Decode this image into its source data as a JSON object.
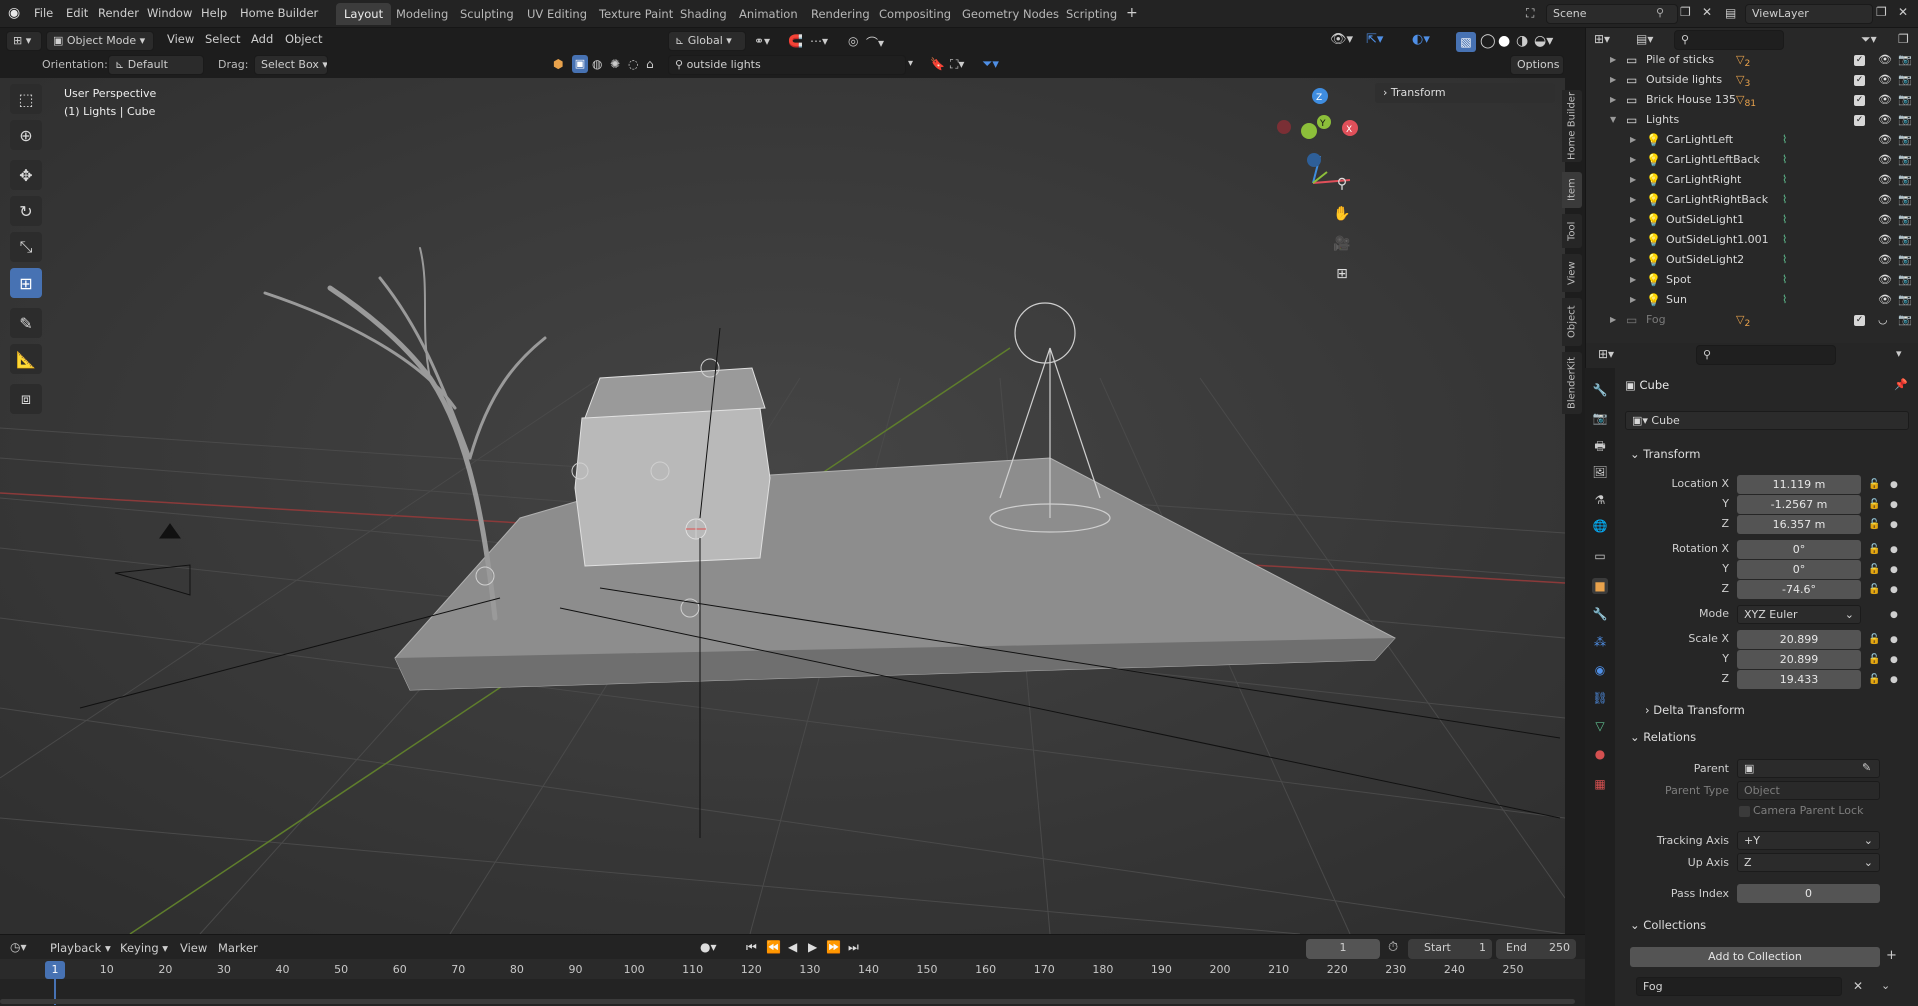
{
  "topbar": {
    "menus": [
      "File",
      "Edit",
      "Render",
      "Window",
      "Help",
      "Home Builder"
    ],
    "workspaces": [
      "Layout",
      "Modeling",
      "Sculpting",
      "UV Editing",
      "Texture Paint",
      "Shading",
      "Animation",
      "Rendering",
      "Compositing",
      "Geometry Nodes",
      "Scripting"
    ],
    "active_workspace": "Layout",
    "add_tab": "+",
    "scene": "Scene",
    "view_layer": "ViewLayer"
  },
  "viewport_header": {
    "mode": "Object Mode",
    "menus": [
      "View",
      "Select",
      "Add",
      "Object"
    ],
    "transform_orientation": "Global",
    "orientation_label": "Orientation:",
    "orientation_value": "Default",
    "drag_label": "Drag:",
    "drag_value": "Select Box",
    "search_value": "outside lights",
    "options": "Options"
  },
  "viewport": {
    "view_name": "User Perspective",
    "context": "(1) Lights | Cube",
    "sidebar_panel": "Transform",
    "side_tabs": [
      "Home Builder",
      "Item",
      "Tool",
      "View",
      "Object",
      "BlenderKit"
    ],
    "gizmo_axes": [
      "Z",
      "Y",
      "X"
    ]
  },
  "outliner": {
    "rows": [
      {
        "label": "Pile of sticks",
        "extra": "2",
        "kind": "collection"
      },
      {
        "label": "Outside lights",
        "extra": "3",
        "kind": "collection"
      },
      {
        "label": "Brick House 135",
        "extra": "81",
        "kind": "collection"
      },
      {
        "label": "Lights",
        "extra": "",
        "kind": "collection"
      },
      {
        "label": "CarLightLeft",
        "extra": "",
        "kind": "light"
      },
      {
        "label": "CarLightLeftBack",
        "extra": "",
        "kind": "light"
      },
      {
        "label": "CarLightRight",
        "extra": "",
        "kind": "light"
      },
      {
        "label": "CarLightRightBack",
        "extra": "",
        "kind": "light"
      },
      {
        "label": "OutSideLight1",
        "extra": "",
        "kind": "light"
      },
      {
        "label": "OutSideLight1.001",
        "extra": "",
        "kind": "light"
      },
      {
        "label": "OutSideLight2",
        "extra": "",
        "kind": "light"
      },
      {
        "label": "Spot",
        "extra": "",
        "kind": "light"
      },
      {
        "label": "Sun",
        "extra": "",
        "kind": "light"
      },
      {
        "label": "Fog",
        "extra": "2",
        "kind": "collection-dim"
      }
    ]
  },
  "properties": {
    "object_name": "Cube",
    "data_name": "Cube",
    "transform_title": "Transform",
    "location_label": "Location X",
    "location": [
      "11.119 m",
      "-1.2567 m",
      "16.357 m"
    ],
    "rotation_label": "Rotation X",
    "rotation": [
      "0°",
      "0°",
      "-74.6°"
    ],
    "mode_label": "Mode",
    "mode_value": "XYZ Euler",
    "scale_label": "Scale X",
    "scale": [
      "20.899",
      "20.899",
      "19.433"
    ],
    "axis_y": "Y",
    "axis_z": "Z",
    "delta_transform": "Delta Transform",
    "relations_title": "Relations",
    "parent_label": "Parent",
    "parent_type_label": "Parent Type",
    "parent_type_value": "Object",
    "camera_parent_lock": "Camera Parent Lock",
    "tracking_axis_label": "Tracking Axis",
    "tracking_axis_value": "+Y",
    "up_axis_label": "Up Axis",
    "up_axis_value": "Z",
    "pass_index_label": "Pass Index",
    "pass_index_value": "0",
    "collections_title": "Collections",
    "add_to_collection": "Add to Collection",
    "collection_name": "Fog"
  },
  "timeline": {
    "menus": [
      "Playback",
      "Keying",
      "View",
      "Marker"
    ],
    "current_frame": "1",
    "start_label": "Start",
    "start_value": "1",
    "end_label": "End",
    "end_value": "250",
    "ticks": [
      "1",
      "10",
      "20",
      "30",
      "40",
      "50",
      "60",
      "70",
      "80",
      "90",
      "100",
      "110",
      "120",
      "130",
      "140",
      "150",
      "160",
      "170",
      "180",
      "190",
      "200",
      "210",
      "220",
      "230",
      "240",
      "250"
    ]
  },
  "colors": {
    "accent": "#4772b3",
    "axis_x": "#e0505a",
    "axis_y": "#8cbf3a",
    "axis_z": "#3f8de0",
    "light_icon": "#e8a24c",
    "vertex_group": "#5fbf8f"
  }
}
